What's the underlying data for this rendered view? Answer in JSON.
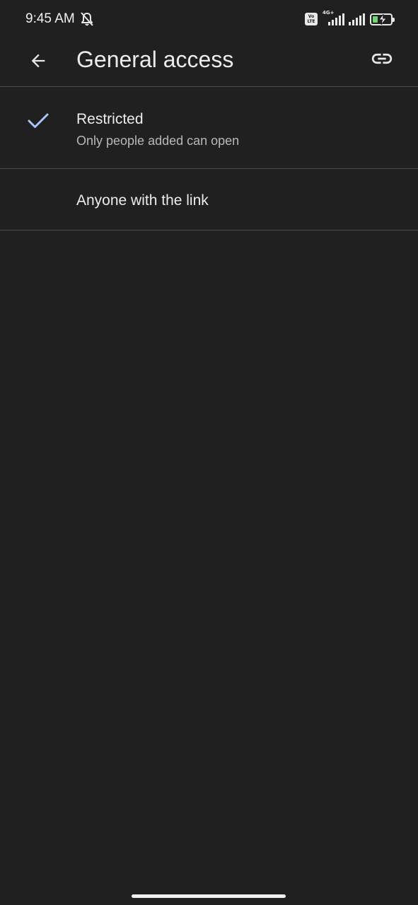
{
  "status_bar": {
    "time": "9:45 AM",
    "volte_top": "Vo",
    "volte_bottom": "LTE",
    "network_label": "4G+",
    "icons": [
      "mute-icon",
      "volte-icon",
      "signal-icon",
      "signal-icon",
      "battery-charging-icon"
    ],
    "battery_fill_color": "#6fd36f"
  },
  "app_bar": {
    "title": "General access",
    "back_icon": "arrow-back-icon",
    "link_icon": "link-icon"
  },
  "options": [
    {
      "title": "Restricted",
      "subtitle": "Only people added can open",
      "selected": true,
      "icon": "check-icon",
      "icon_color": "#a8c7fa"
    },
    {
      "title": "Anyone with the link",
      "selected": false
    }
  ],
  "colors": {
    "background": "#202020",
    "divider": "#4a4a4a",
    "text_primary": "#ececec",
    "text_secondary": "#b8b8b8"
  }
}
